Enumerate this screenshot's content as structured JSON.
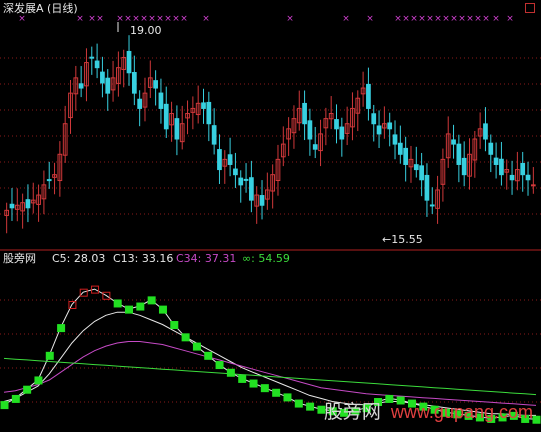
{
  "header": {
    "title": "深发展A (日线)"
  },
  "sub_panel": {
    "title": "股旁网",
    "indicators": [
      {
        "key": "C5",
        "label": "C5: 28.03",
        "color": "#e8e8e8"
      },
      {
        "key": "C13",
        "label": "C13: 33.16",
        "color": "#e8e8e8"
      },
      {
        "key": "C34",
        "label": "C34: 37.31",
        "color": "#c64ac6"
      },
      {
        "key": "INF",
        "label": "∞: 54.59",
        "color": "#3cdc3c"
      }
    ]
  },
  "watermark": {
    "cn": "股旁网",
    "en": "www.gupang.com"
  },
  "colors": {
    "up": "#d0383a",
    "down": "#38d0e0",
    "marker": "#d040d0",
    "green_step": "#22e022",
    "red_step": "#d02020",
    "grid": "#8a1a1a"
  },
  "chart_data": [
    {
      "type": "candlestick",
      "title": "深发展A (日线)",
      "annotations": [
        {
          "label": "19.00",
          "value": 19.0
        },
        {
          "label": "←15.55",
          "value": 15.55
        }
      ],
      "ylim": [
        15.2,
        19.4
      ],
      "close": [
        15.9,
        15.95,
        16.0,
        16.05,
        15.95,
        16.1,
        16.2,
        16.4,
        16.5,
        16.6,
        17.0,
        17.6,
        18.2,
        18.5,
        18.3,
        18.8,
        18.9,
        18.7,
        18.4,
        18.2,
        18.5,
        18.7,
        18.9,
        18.6,
        18.2,
        17.9,
        18.2,
        18.5,
        18.3,
        17.9,
        17.5,
        17.8,
        17.3,
        17.6,
        17.8,
        17.9,
        18.0,
        17.9,
        17.6,
        17.2,
        16.7,
        16.9,
        16.8,
        16.6,
        16.4,
        16.5,
        16.1,
        16.2,
        16.0,
        16.3,
        16.6,
        16.9,
        17.2,
        17.5,
        17.7,
        17.9,
        17.6,
        17.3,
        17.1,
        17.4,
        17.7,
        17.8,
        17.5,
        17.3,
        17.6,
        17.9,
        18.1,
        18.3,
        17.9,
        17.6,
        17.4,
        17.6,
        17.5,
        17.2,
        17.0,
        16.8,
        16.9,
        16.7,
        16.5,
        16.1,
        16.0,
        16.3,
        16.9,
        17.4,
        17.2,
        16.8,
        16.6,
        17.0,
        17.3,
        17.5,
        17.3,
        17.0,
        16.8,
        16.6,
        16.7,
        16.5,
        16.7,
        16.6,
        16.5,
        16.4
      ],
      "markers_top": "pink x markers along the top edge"
    },
    {
      "type": "line",
      "series": [
        {
          "name": "C5",
          "color": "#e8e8e8",
          "values": [
            10.0,
            14.0,
            20.0,
            26.0,
            42.0,
            60.0,
            75.0,
            83.0,
            85.0,
            81.0,
            76.0,
            72.0,
            74.0,
            78.0,
            72.0,
            62.0,
            54.0,
            48.0,
            42.0,
            36.0,
            31.0,
            27.0,
            24.0,
            21.0,
            18.0,
            15.0,
            11.0,
            9.0,
            7.0,
            6.0,
            5.0,
            6.0,
            8.0,
            12.0,
            14.0,
            13.0,
            11.0,
            9.0,
            7.0,
            5.0,
            4.0,
            3.0,
            2.0,
            1.0,
            2.0,
            3.0,
            1.0,
            0.5
          ]
        },
        {
          "name": "C13",
          "color": "#e8e8e8",
          "values": [
            12.0,
            14.0,
            18.0,
            22.0,
            30.0,
            40.0,
            50.0,
            58.0,
            64.0,
            68.0,
            70.0,
            70.0,
            68.0,
            65.0,
            62.0,
            58.0,
            54.0,
            50.0,
            46.0,
            42.0,
            38.0,
            34.0,
            31.0,
            28.0,
            25.0,
            22.0,
            19.0,
            16.0,
            14.0,
            12.0,
            11.0,
            10.0,
            10.0,
            11.0,
            12.0,
            12.0,
            11.0,
            10.0,
            9.0,
            8.0,
            7.0,
            6.0,
            5.0,
            4.0,
            4.0,
            3.5,
            3.0,
            3.0
          ]
        },
        {
          "name": "C34",
          "color": "#c64ac6",
          "values": [
            18.0,
            19.0,
            21.0,
            23.0,
            26.0,
            31.0,
            36.0,
            41.0,
            45.0,
            48.0,
            50.0,
            51.0,
            51.0,
            50.0,
            49.0,
            47.0,
            45.0,
            43.0,
            41.0,
            39.0,
            37.0,
            35.0,
            33.0,
            31.0,
            29.0,
            27.0,
            25.0,
            23.0,
            21.0,
            20.0,
            19.0,
            18.0,
            17.0,
            16.5,
            16.0,
            15.5,
            15.0,
            14.5,
            14.0,
            13.5,
            13.0,
            12.5,
            12.0,
            11.5,
            11.0,
            10.5,
            10.0,
            9.5
          ]
        },
        {
          "name": "∞",
          "color": "#3cdc3c",
          "values": [
            40.0,
            39.5,
            39.0,
            38.5,
            38.0,
            37.5,
            37.0,
            36.5,
            36.0,
            35.5,
            35.0,
            34.5,
            34.0,
            33.5,
            33.0,
            32.5,
            32.0,
            31.5,
            31.0,
            30.5,
            30.0,
            29.5,
            29.0,
            28.5,
            28.0,
            27.5,
            27.0,
            26.5,
            26.0,
            25.5,
            25.0,
            24.5,
            24.0,
            23.5,
            23.0,
            22.5,
            22.0,
            21.5,
            21.0,
            20.5,
            20.0,
            19.5,
            19.0,
            18.5,
            18.0,
            17.5,
            17.0,
            16.5
          ]
        }
      ],
      "ylim": [
        0,
        100
      ]
    }
  ]
}
